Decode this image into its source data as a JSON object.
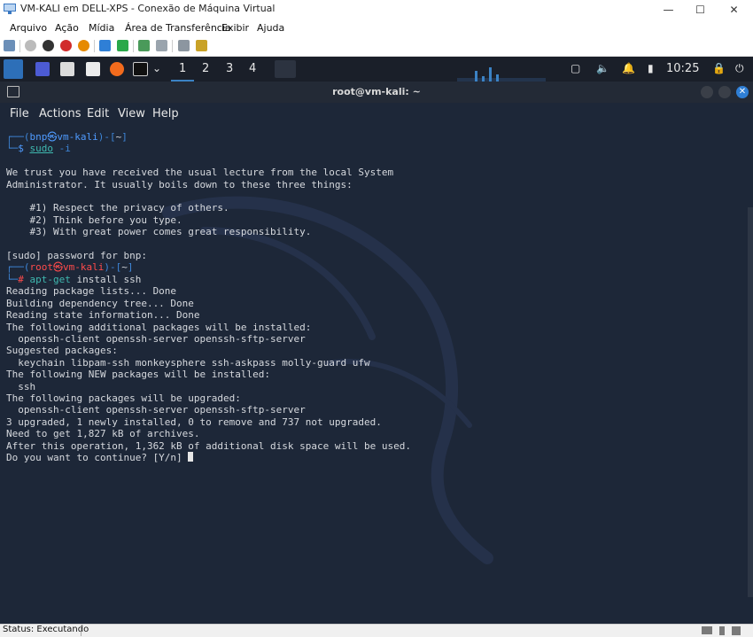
{
  "window": {
    "title": "VM-KALI em DELL-XPS - Conexão de Máquina Virtual"
  },
  "host_menu": [
    "Arquivo",
    "Ação",
    "Mídia",
    "Área de Transferência",
    "Exibir",
    "Ajuda"
  ],
  "panel": {
    "workspaces": [
      "1",
      "2",
      "3",
      "4"
    ],
    "active_workspace": "1",
    "clock": "10:25"
  },
  "terminal": {
    "title": "root@vm-kali: ~",
    "menu": [
      "File",
      "Actions",
      "Edit",
      "View",
      "Help"
    ],
    "p1_user": "bnp",
    "p1_host": "vm-kali",
    "p1_dir": "~",
    "p1_cmd": "sudo",
    "p1_arg": "-i",
    "lecture_1": "We trust you have received the usual lecture from the local System",
    "lecture_2": "Administrator. It usually boils down to these three things:",
    "rule_1": "    #1) Respect the privacy of others.",
    "rule_2": "    #2) Think before you type.",
    "rule_3": "    #3) With great power comes great responsibility.",
    "sudo_prompt": "[sudo] password for bnp:",
    "p2_user": "root",
    "p2_host": "vm-kali",
    "p2_dir": "~",
    "p2_cmd": "apt-get",
    "p2_args": "install ssh",
    "out": [
      "Reading package lists... Done",
      "Building dependency tree... Done",
      "Reading state information... Done",
      "The following additional packages will be installed:",
      "  openssh-client openssh-server openssh-sftp-server",
      "Suggested packages:",
      "  keychain libpam-ssh monkeysphere ssh-askpass molly-guard ufw",
      "The following NEW packages will be installed:",
      "  ssh",
      "The following packages will be upgraded:",
      "  openssh-client openssh-server openssh-sftp-server",
      "3 upgraded, 1 newly installed, 0 to remove and 737 not upgraded.",
      "Need to get 1,827 kB of archives.",
      "After this operation, 1,362 kB of additional disk space will be used."
    ],
    "question": "Do you want to continue? [Y/n] "
  },
  "status": {
    "text": "Status: Executando"
  },
  "colors": {
    "terminal_bg": "#1d2738",
    "prompt_blue": "#4f9bff",
    "prompt_red": "#ff4b4b",
    "panel_accent": "#3b82c4"
  }
}
